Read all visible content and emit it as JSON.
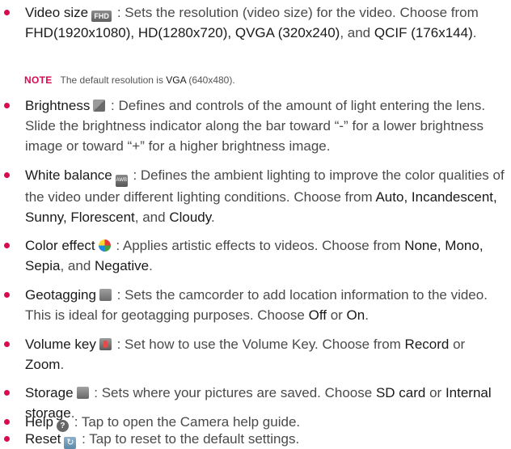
{
  "items": [
    {
      "term": "Video size",
      "icon": "fhd-icon",
      "icon_text": "FHD",
      "desc_a": " : Sets the resolution (video size) for the video. Choose from  ",
      "opt1": "FHD(1920x1080), HD(1280x720), QVGA (320x240)",
      "desc_b": ", and ",
      "opt2": "QCIF (176x144)",
      "desc_c": "."
    },
    {
      "term": "Brightness",
      "icon": "brightness-icon",
      "desc_a": " : Defines and controls of the amount of light entering the lens. Slide the brightness indicator along the bar toward “-” for a lower brightness image or toward “+” for a higher brightness image."
    },
    {
      "term": "White balance",
      "icon": "white-balance-icon",
      "icon_text": "AWB",
      "desc_a": " : Defines the ambient lighting to improve the color qualities of the video under different lighting conditions. Choose from ",
      "opt1": "Auto, Incandescent, Sunny, Florescent",
      "desc_b": ", and ",
      "opt2": "Cloudy",
      "desc_c": "."
    },
    {
      "term": "Color effect",
      "icon": "color-effect-icon",
      "desc_a": " : Applies artistic effects to videos. Choose from ",
      "opt1": "None, Mono, Sepia",
      "desc_b": ", and ",
      "opt2": "Negative",
      "desc_c": "."
    },
    {
      "term": "Geotagging",
      "icon": "geotagging-icon",
      "desc_a": " : Sets the camcorder to add location information to the video. This is ideal for geotagging purposes. Choose ",
      "opt1": "Off",
      "desc_b": " or ",
      "opt2": "On",
      "desc_c": "."
    },
    {
      "term": "Volume key",
      "icon": "volume-key-icon",
      "desc_a": " : Set how to use the Volume Key. Choose from ",
      "opt1": "Record",
      "desc_b": " or ",
      "opt2": "Zoom",
      "desc_c": "."
    },
    {
      "term": "Storage",
      "icon": "storage-icon",
      "desc_a": " : Sets where your pictures are saved. Choose ",
      "opt1": "SD card",
      "desc_b": " or ",
      "opt2": "Internal storage",
      "desc_c": "."
    },
    {
      "term": "Help",
      "icon": "help-icon",
      "icon_text": "?",
      "desc_a": " : Tap to open the Camera help guide."
    },
    {
      "term": "Reset",
      "icon": "reset-icon",
      "icon_text": "↻",
      "desc_a": " : Tap to reset to the default settings."
    }
  ],
  "note": {
    "label": "NOTE",
    "text_a": "The default resolution is ",
    "value": "VGA",
    "text_b": " (640x480)."
  },
  "colors": {
    "bullet": "#d70a52",
    "note_label": "#d70a52",
    "body_text": "#4a4a4a",
    "term_text": "#1a1a1a"
  }
}
